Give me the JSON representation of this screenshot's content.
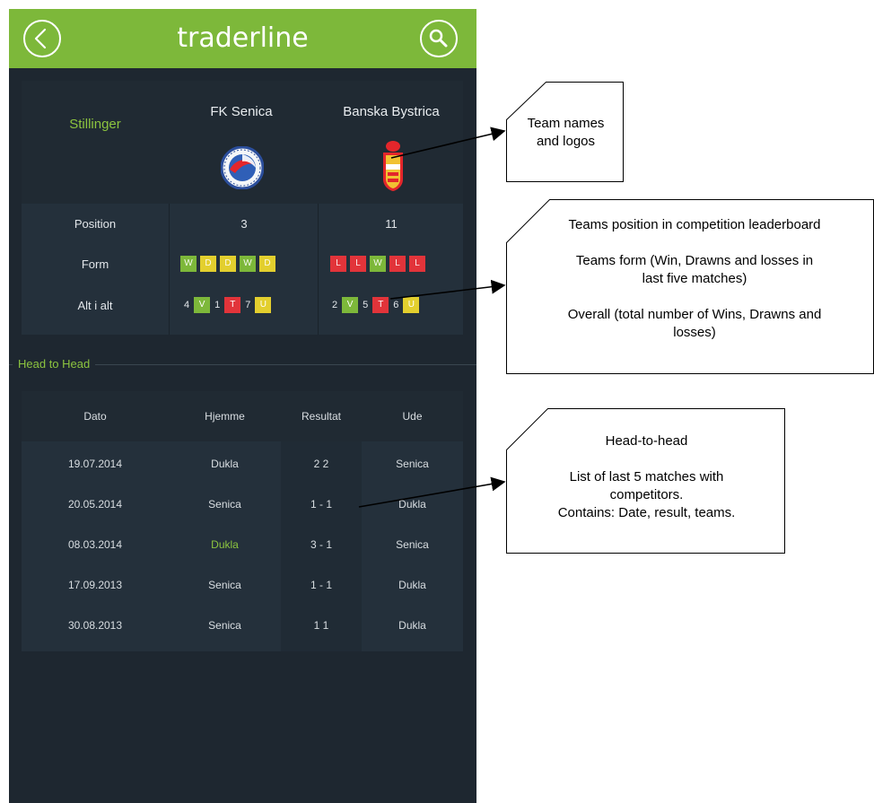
{
  "app": {
    "title": "traderline"
  },
  "header": {
    "stillinger": "Stillinger",
    "home_team": "FK Senica",
    "away_team": "Banska Bystrica"
  },
  "stats": {
    "position_label": "Position",
    "form_label": "Form",
    "overall_label": "Alt i alt",
    "home_position": "3",
    "away_position": "11",
    "home_form": [
      "W",
      "D",
      "D",
      "W",
      "D"
    ],
    "away_form": [
      "L",
      "L",
      "W",
      "L",
      "L"
    ],
    "home_overall": {
      "wins": "4",
      "win_label": "V",
      "draws": "1",
      "draw_label": "T",
      "losses": "7",
      "loss_label": "U"
    },
    "away_overall": {
      "wins": "2",
      "win_label": "V",
      "draws": "5",
      "draw_label": "T",
      "losses": "6",
      "loss_label": "U"
    }
  },
  "h2h": {
    "title": "Head to Head",
    "columns": {
      "date": "Dato",
      "home": "Hjemme",
      "result": "Resultat",
      "away": "Ude"
    },
    "rows": [
      {
        "date": "19.07.2014",
        "home": "Dukla",
        "result": "2 2",
        "away": "Senica"
      },
      {
        "date": "20.05.2014",
        "home": "Senica",
        "result": "1 - 1",
        "away": "Dukla"
      },
      {
        "date": "08.03.2014",
        "home": "Dukla",
        "result": "3 - 1",
        "away": "Senica"
      },
      {
        "date": "17.09.2013",
        "home": "Senica",
        "result": "1 - 1",
        "away": "Dukla"
      },
      {
        "date": "30.08.2013",
        "home": "Senica",
        "result": "1 1",
        "away": "Dukla"
      }
    ]
  },
  "annotations": {
    "team_names": [
      "Team names",
      "and logos"
    ],
    "teams_info": [
      "Teams position in competition leaderboard",
      "",
      "Teams form (Win, Drawns and losses in",
      "last five matches)",
      "",
      "Overall (total number of Wins, Drawns and",
      "losses)"
    ],
    "head_to_head": [
      "Head-to-head",
      "",
      "List of last 5 matches with",
      "competitors.",
      "Contains: Date, result, teams."
    ]
  },
  "colors": {
    "accent": "#7db83a",
    "win": "#7db83a",
    "draw": "#e3cf2e",
    "loss": "#e2343a",
    "bg": "#1e2730"
  }
}
